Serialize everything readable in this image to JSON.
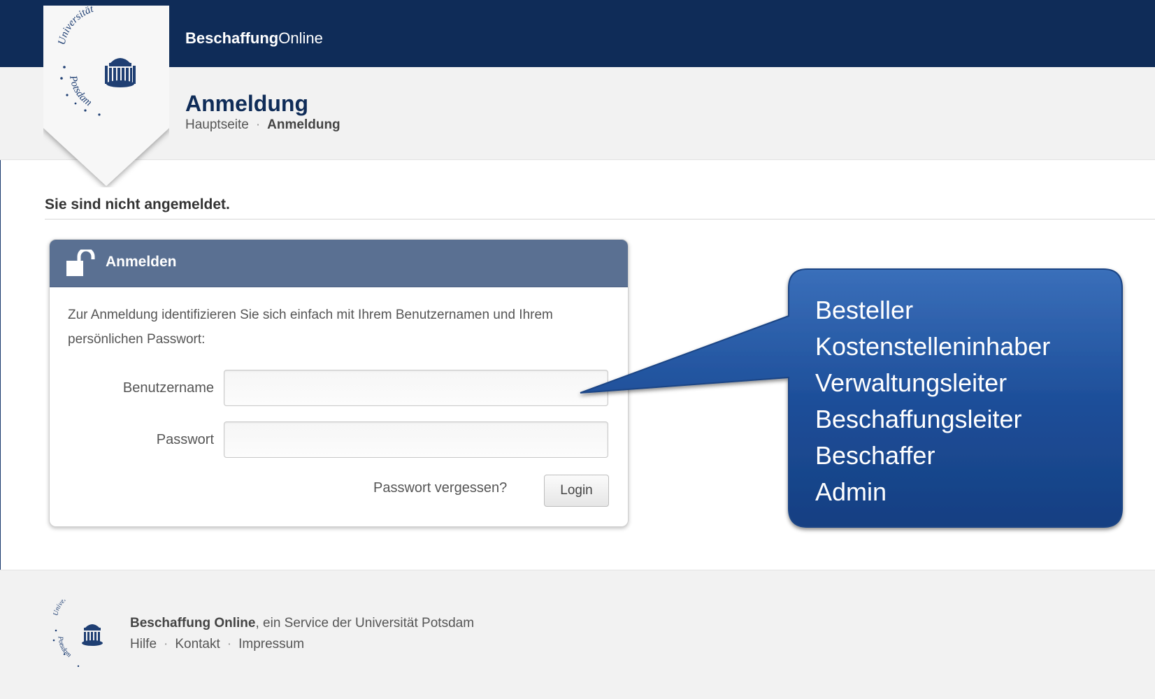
{
  "header": {
    "brand_bold": "Beschaffung",
    "brand_rest": "Online",
    "page_title": "Anmeldung",
    "breadcrumb": {
      "home": "Hauptseite",
      "separator": "·",
      "current": "Anmeldung"
    }
  },
  "logo": {
    "top_text": "Universität",
    "bottom_text": "Potsdam",
    "icon": "university-building-icon"
  },
  "status": {
    "text": "Sie sind nicht angemeldet."
  },
  "login_panel": {
    "title": "Anmelden",
    "icon": "unlocked-padlock-icon",
    "intro": "Zur Anmeldung identifizieren Sie sich einfach mit Ihrem Benutzernamen und Ihrem persönlichen Passwort:",
    "username_label": "Benutzername",
    "username_value": "",
    "password_label": "Passwort",
    "password_value": "",
    "forgot_link": "Passwort vergessen?",
    "login_button": "Login"
  },
  "callout": {
    "roles": [
      "Besteller",
      "Kostenstelleninhaber",
      "Verwaltungsleiter",
      "Beschaffungsleiter",
      "Beschaffer",
      "Admin"
    ]
  },
  "footer": {
    "service_name": "Beschaffung Online",
    "service_rest": ", ein Service der Universität Potsdam",
    "links": [
      "Hilfe",
      "Kontakt",
      "Impressum"
    ],
    "separator": "·"
  },
  "colors": {
    "topbar": "#0f2c58",
    "panel_header": "#5a7092",
    "callout_fill": "#1e4f9a",
    "page_background": "#ffffff",
    "header_background": "#f2f2f2"
  }
}
